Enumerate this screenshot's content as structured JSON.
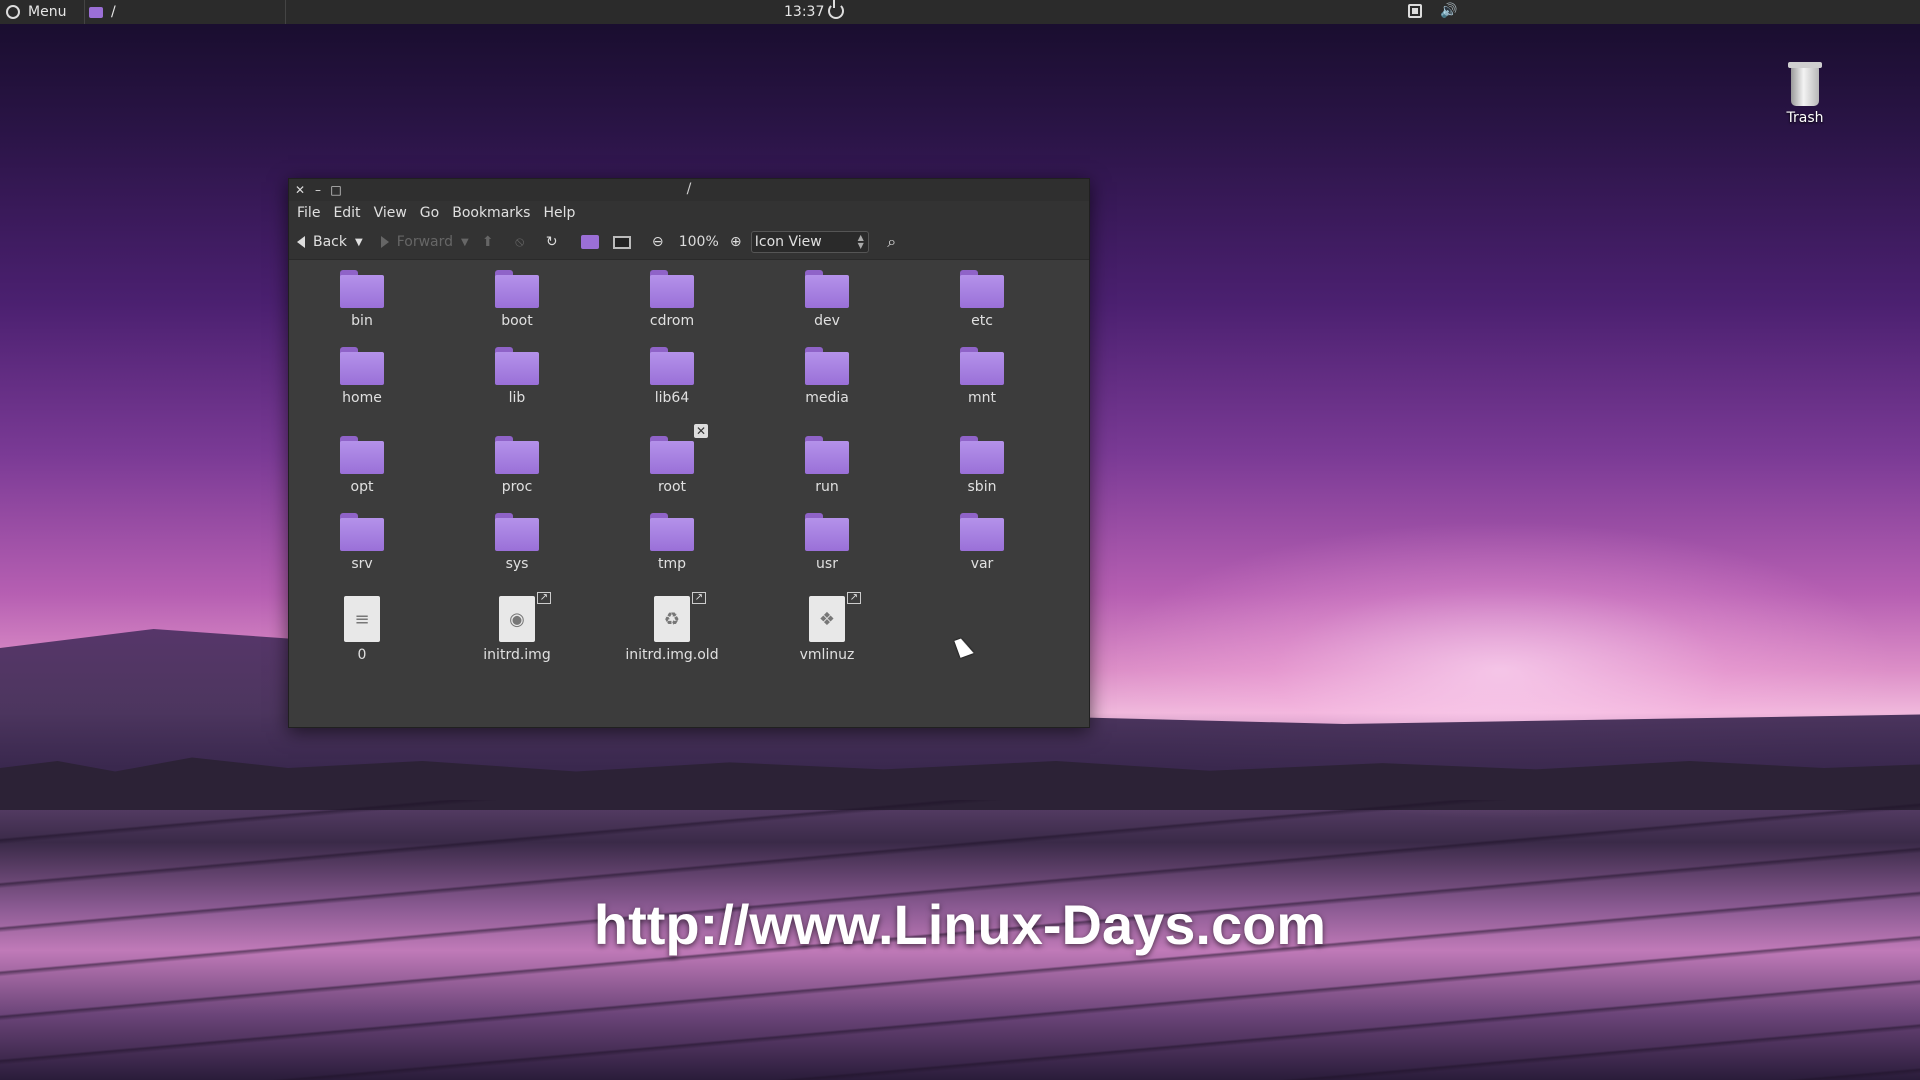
{
  "panel": {
    "menu_label": "Menu",
    "task_title": "/",
    "clock": "13:37",
    "icons": [
      "power-icon",
      "screenshot-icon",
      "volume-icon"
    ]
  },
  "desktop": {
    "trash_label": "Trash"
  },
  "window": {
    "title": "/",
    "controls": [
      "close",
      "minimize",
      "maximize"
    ],
    "menu": [
      "File",
      "Edit",
      "View",
      "Go",
      "Bookmarks",
      "Help"
    ],
    "toolbar": {
      "back_label": "Back",
      "forward_label": "Forward",
      "zoom_level": "100%",
      "view_mode": "Icon View"
    },
    "items": [
      {
        "name": "bin",
        "type": "folder"
      },
      {
        "name": "boot",
        "type": "folder"
      },
      {
        "name": "cdrom",
        "type": "folder"
      },
      {
        "name": "dev",
        "type": "folder"
      },
      {
        "name": "etc",
        "type": "folder"
      },
      {
        "name": "home",
        "type": "folder"
      },
      {
        "name": "lib",
        "type": "folder"
      },
      {
        "name": "lib64",
        "type": "folder"
      },
      {
        "name": "media",
        "type": "folder"
      },
      {
        "name": "mnt",
        "type": "folder"
      },
      {
        "name": "opt",
        "type": "folder"
      },
      {
        "name": "proc",
        "type": "folder"
      },
      {
        "name": "root",
        "type": "folder-locked"
      },
      {
        "name": "run",
        "type": "folder"
      },
      {
        "name": "sbin",
        "type": "folder"
      },
      {
        "name": "srv",
        "type": "folder"
      },
      {
        "name": "sys",
        "type": "folder"
      },
      {
        "name": "tmp",
        "type": "folder"
      },
      {
        "name": "usr",
        "type": "folder"
      },
      {
        "name": "var",
        "type": "folder"
      },
      {
        "name": "0",
        "type": "text-file"
      },
      {
        "name": "initrd.img",
        "type": "disk-image-link"
      },
      {
        "name": "initrd.img.old",
        "type": "archive-link"
      },
      {
        "name": "vmlinuz",
        "type": "binary-link"
      }
    ]
  },
  "watermark": "http://www.Linux-Days.com",
  "colors": {
    "folder": "#9a70d8",
    "panel_bg": "#2b2b2b",
    "window_bg": "#3c3c3c"
  }
}
